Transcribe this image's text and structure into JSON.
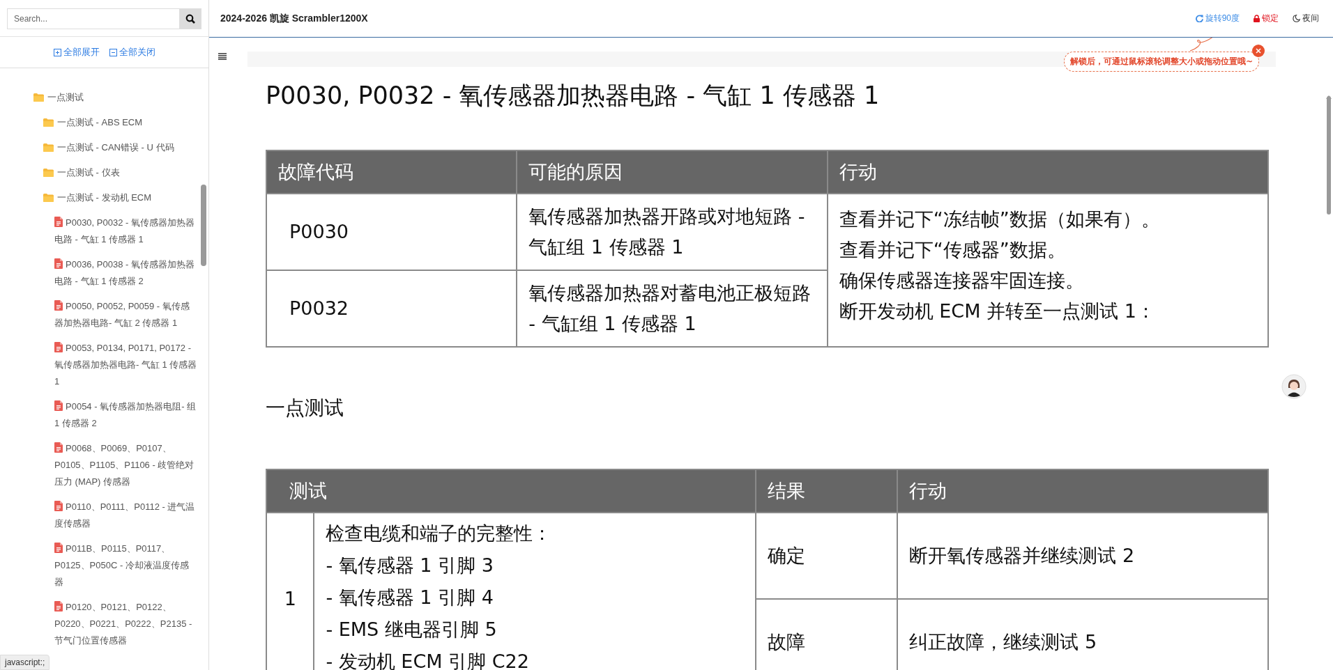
{
  "header": {
    "title": "2024-2026 凯旋 Scrambler1200X",
    "actions": [
      {
        "kind": "rotate",
        "label": "旋转90度"
      },
      {
        "kind": "lock",
        "label": "锁定"
      },
      {
        "kind": "night",
        "label": "夜间"
      }
    ]
  },
  "tooltip": {
    "text": "解锁后，可通过鼠标滚轮调整大小或拖动位置哦~"
  },
  "sidebar": {
    "search": {
      "placeholder": "Search..."
    },
    "expand_all": "全部展开",
    "collapse_all": "全部关闭",
    "tree": [
      {
        "kind": "folder",
        "label": "一点测试",
        "children": [
          {
            "kind": "folder",
            "label": "一点测试 - ABS ECM"
          },
          {
            "kind": "folder",
            "label": "一点测试 - CAN错误 - U 代码"
          },
          {
            "kind": "folder",
            "label": "一点测试 - 仪表"
          },
          {
            "kind": "folder",
            "label": "一点测试 - 发动机 ECM",
            "children": [
              {
                "kind": "doc",
                "label": "P0030, P0032 - 氧传感器加热器电路 - 气缸 1 传感器 1"
              },
              {
                "kind": "doc",
                "label": "P0036, P0038 - 氧传感器加热器电路 - 气缸 1 传感器 2"
              },
              {
                "kind": "doc",
                "label": "P0050, P0052, P0059 - 氧传感器加热器电路- 气缸 2 传感器 1"
              },
              {
                "kind": "doc",
                "label": "P0053, P0134, P0171, P0172 - 氧传感器加热器电路- 气缸 1 传感器 1"
              },
              {
                "kind": "doc",
                "label": "P0054 - 氧传感器加热器电阻- 组 1 传感器 2"
              },
              {
                "kind": "doc",
                "label": "P0068、P0069、P0107、P0105、P1105、P1106 - 歧管绝对压力 (MAP) 传感器"
              },
              {
                "kind": "doc",
                "label": "P0110、P0111、P0112 - 进气温度传感器"
              },
              {
                "kind": "doc",
                "label": "P011B、P0115、P0117、P0125、P050C - 冷却液温度传感器"
              },
              {
                "kind": "doc",
                "label": "P0120、P0121、P0122、P0220、P0221、P0222、P2135 - 节气门位置传感器"
              }
            ]
          }
        ]
      }
    ]
  },
  "status_tip": "javascript:;",
  "article": {
    "title": "P0030, P0032 - 氧传感器加热器电路 - 气缸 1 传感器 1",
    "fault_table": {
      "columns": [
        "故障代码",
        "可能的原因",
        "行动"
      ],
      "rows": [
        {
          "code": "P0030",
          "cause": "氧传感器加热器开路或对地短路 - 气缸组 1 传感器 1"
        },
        {
          "code": "P0032",
          "cause": "氧传感器加热器对蓄电池正极短路 - 气缸组 1 传感器 1"
        }
      ],
      "action_lines": [
        "查看并记下“冻结帧”数据（如果有）。",
        "查看并记下“传感器”数据。",
        "确保传感器连接器牢固连接。",
        "断开发动机 ECM 并转至一点测试 1："
      ]
    },
    "section_heading": "一点测试",
    "test_table": {
      "columns": [
        "测试",
        "结果",
        "行动"
      ],
      "tests": [
        {
          "number": "1",
          "lines": [
            "检查电缆和端子的完整性：",
            "- 氧传感器 1 引脚 3",
            "- 氧传感器 1 引脚 4",
            "- EMS 继电器引脚 5",
            "- 发动机 ECM 引脚 C22"
          ],
          "outcomes": [
            {
              "result": "确定",
              "action": "断开氧传感器并继续测试 2"
            },
            {
              "result": "故障",
              "action": "纠正故障，继续测试 5"
            }
          ]
        }
      ]
    }
  }
}
